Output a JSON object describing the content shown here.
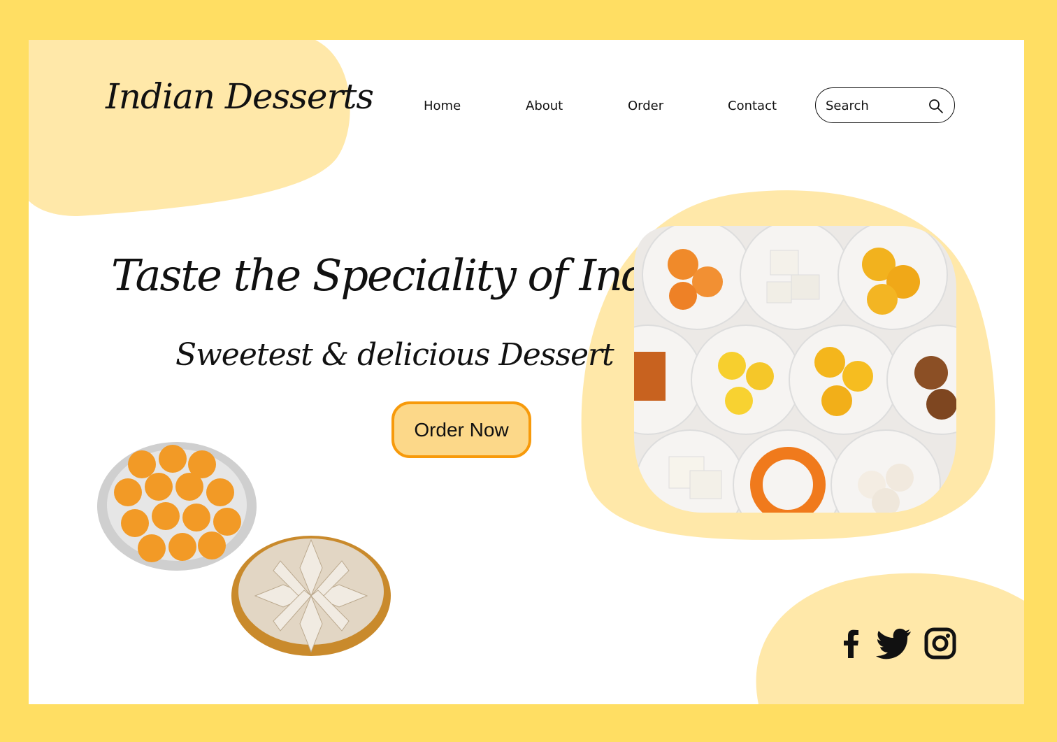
{
  "brand": {
    "logo_text": "Indian Desserts"
  },
  "nav": {
    "items": [
      {
        "label": "Home"
      },
      {
        "label": "About"
      },
      {
        "label": "Order"
      },
      {
        "label": "Contact"
      }
    ]
  },
  "search": {
    "placeholder": "Search",
    "icon": "search-icon"
  },
  "hero": {
    "headline": "Taste the Speciality of India",
    "subheadline": "Sweetest & delicious Dessert",
    "cta_label": "Order Now",
    "image": "assorted-sweets-bowls"
  },
  "decor_images": [
    "motichoor-ladoo-plate",
    "kaju-katli-plate"
  ],
  "social": [
    {
      "icon": "facebook-icon"
    },
    {
      "icon": "twitter-icon"
    },
    {
      "icon": "instagram-icon"
    }
  ],
  "colors": {
    "page_border": "#ffde63",
    "blob": "#ffe8a9",
    "cta_fill": "#fcd889",
    "cta_border": "#f79a0b",
    "text": "#111111"
  }
}
